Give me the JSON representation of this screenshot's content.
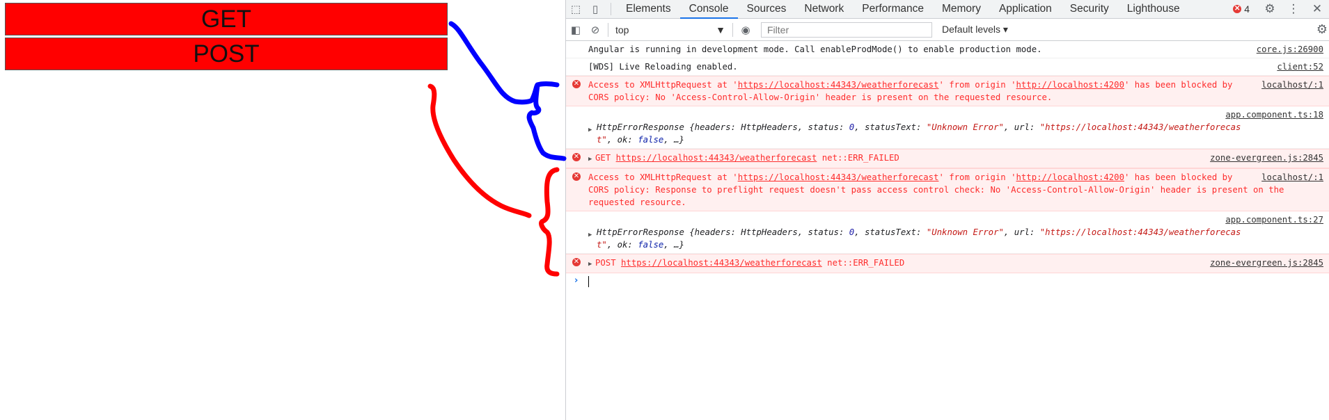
{
  "app": {
    "get_label": "GET",
    "post_label": "POST"
  },
  "devtools": {
    "tabs": [
      "Elements",
      "Console",
      "Sources",
      "Network",
      "Performance",
      "Memory",
      "Application",
      "Security",
      "Lighthouse"
    ],
    "active_tab": "Console",
    "error_count": "4",
    "context": "top",
    "filter_placeholder": "Filter",
    "levels_label": "Default levels ▾"
  },
  "console": {
    "msg1": {
      "text": "Angular is running in development mode. Call enableProdMode() to enable production mode.",
      "src": "core.js:26900"
    },
    "msg2": {
      "text": "[WDS] Live Reloading enabled.",
      "src": "client:52"
    },
    "err1": {
      "pre": "Access to XMLHttpRequest at '",
      "url1": "https://localhost:44343/weatherforecast",
      "mid": "' from origin '",
      "url2": "http://localhost:4200",
      "post": "' has been blocked by CORS policy: No 'Access-Control-Allow-Origin' header is present on the requested resource.",
      "src": "localhost/:1"
    },
    "obj1": {
      "src": "app.component.ts:18",
      "name": "HttpErrorResponse",
      "headers": "{headers: HttpHeaders, status: ",
      "status": "0",
      "statusText_label": ", statusText: ",
      "statusText": "\"Unknown Error\"",
      "url_label": ", url: ",
      "url": "\"https://localhost:44343/weatherforecas",
      "url_tail": "t\"",
      "ok_label": ", ok: ",
      "ok": "false",
      "rest": ", …}"
    },
    "get_fail": {
      "method": "GET",
      "url": "https://localhost:44343/weatherforecast",
      "status": "net::ERR_FAILED",
      "src": "zone-evergreen.js:2845"
    },
    "err2": {
      "pre": "Access to XMLHttpRequest at '",
      "url1": "https://localhost:44343/weatherforecast",
      "mid": "' from origin '",
      "url2": "http://localhost:4200",
      "post": "' has been blocked by CORS policy: Response to preflight request doesn't pass access control check: No 'Access-Control-Allow-Origin' header is present on the requested resource.",
      "src": "localhost/:1"
    },
    "obj2": {
      "src": "app.component.ts:27",
      "name": "HttpErrorResponse",
      "headers": "{headers: HttpHeaders, status: ",
      "status": "0",
      "statusText_label": ", statusText: ",
      "statusText": "\"Unknown Error\"",
      "url_label": ", url: ",
      "url": "\"https://localhost:44343/weatherforecas",
      "url_tail": "t\"",
      "ok_label": ", ok: ",
      "ok": "false",
      "rest": ", …}"
    },
    "post_fail": {
      "method": "POST",
      "url": "https://localhost:44343/weatherforecast",
      "status": "net::ERR_FAILED",
      "src": "zone-evergreen.js:2845"
    }
  },
  "colors": {
    "button_red": "#ff0000",
    "annotation_blue": "#0000ff",
    "annotation_red": "#ff0000",
    "error_text": "#fe2c2c",
    "error_bg": "#fff0f0"
  }
}
